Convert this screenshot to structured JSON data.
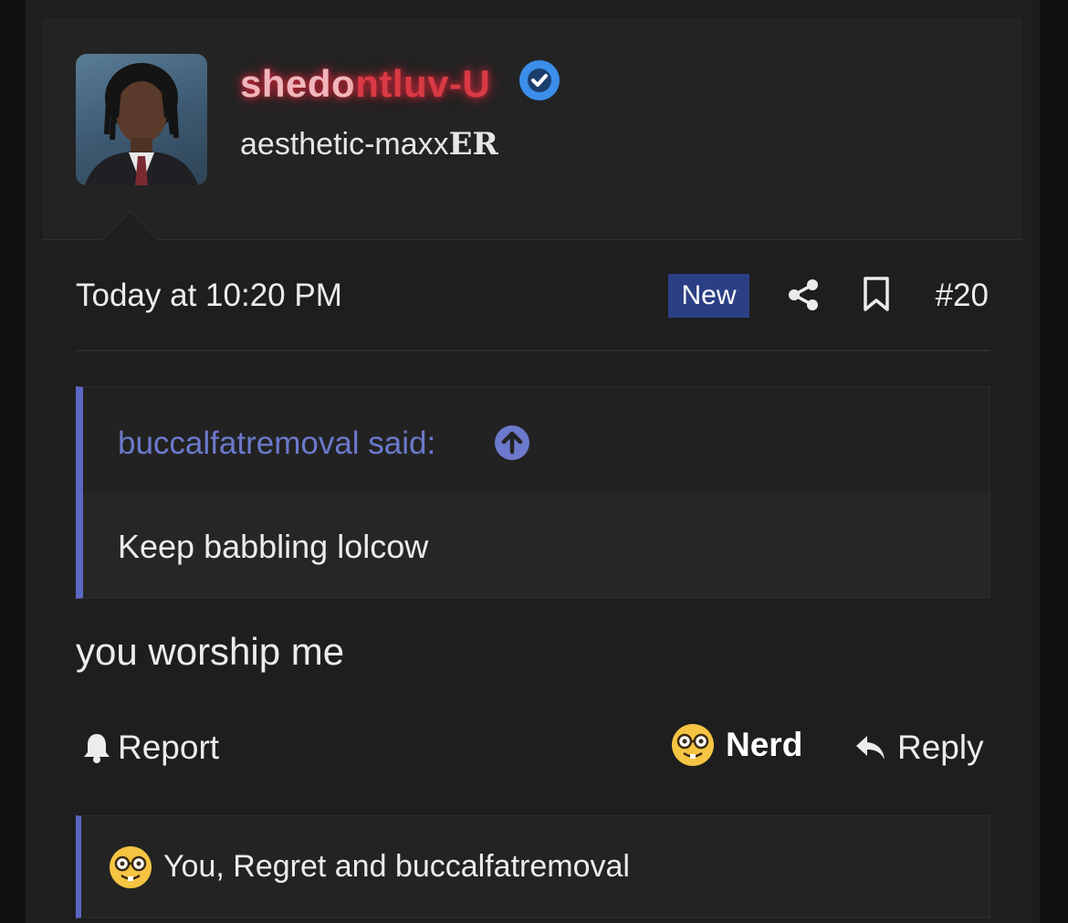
{
  "user": {
    "name_part1": "shedo",
    "name_part2": "ntluv-U",
    "title_part1": "aesthetic-maxx",
    "title_part2": "ER",
    "verified_icon": "verified-check-icon"
  },
  "post": {
    "timestamp": "Today at 10:20 PM",
    "badge": "New",
    "number": "#20",
    "message": "you worship me"
  },
  "quote": {
    "author": "buccalfatremoval said:",
    "text": "Keep babbling lolcow"
  },
  "actions": {
    "report": "Report",
    "reaction": "Nerd",
    "reply": "Reply"
  },
  "reactions_summary": "You, Regret and buccalfatremoval",
  "colors": {
    "accent": "#5b67c4",
    "badge_bg": "#2b3f85",
    "username": "#d93a45",
    "verified": "#3b8eea"
  }
}
